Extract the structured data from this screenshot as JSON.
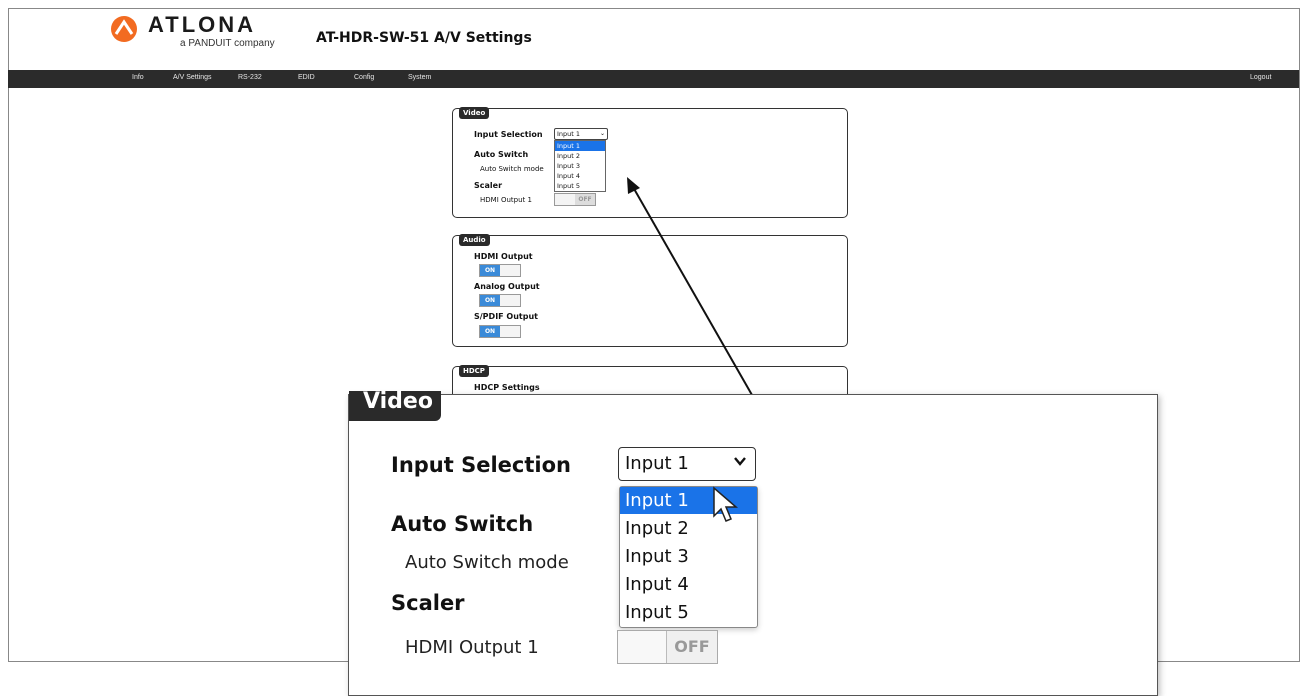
{
  "header": {
    "logo_word": "ATLONA",
    "logo_sub": "a PANDUIT company",
    "title": "AT-HDR-SW-51  A/V Settings"
  },
  "nav": {
    "items": [
      "Info",
      "A/V Settings",
      "RS-232",
      "EDID",
      "Config",
      "System"
    ],
    "logout": "Logout"
  },
  "video": {
    "tag": "Video",
    "input_selection_label": "Input Selection",
    "selected_input": "Input 1",
    "options": [
      "Input 1",
      "Input 2",
      "Input 3",
      "Input 4",
      "Input 5"
    ],
    "auto_switch_label": "Auto Switch",
    "auto_switch_mode_label": "Auto Switch mode",
    "scaler_label": "Scaler",
    "hdmi_output_1_label": "HDMI Output 1",
    "hdmi_output_1_state": "OFF"
  },
  "audio": {
    "tag": "Audio",
    "hdmi_output_label": "HDMI Output",
    "hdmi_output_state": "ON",
    "analog_output_label": "Analog Output",
    "analog_output_state": "ON",
    "spdif_output_label": "S/PDIF Output",
    "spdif_output_state": "ON"
  },
  "hdcp": {
    "tag": "HDCP",
    "settings_label": "HDCP Settings"
  },
  "colors": {
    "navbar": "#2b2b2b",
    "highlight": "#1a73e8",
    "toggle_on": "#3a8ad8",
    "logo_orange": "#f26b21"
  }
}
